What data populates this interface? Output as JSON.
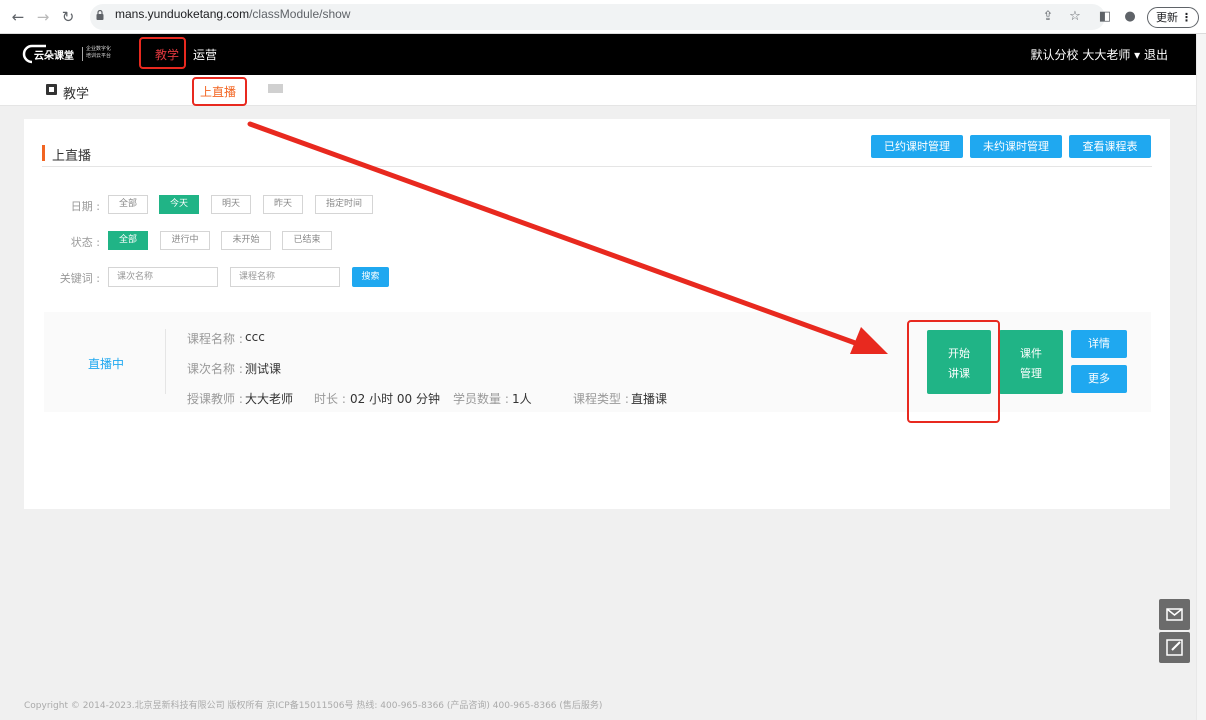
{
  "browser": {
    "url_domain": "mans.yunduoketang.com",
    "url_path": "/classModule/show",
    "update_label": "更新"
  },
  "topnav": {
    "logo_text": "云朵课堂",
    "logo_tagline": "企业数字化 培训云平台",
    "items": [
      {
        "label": "教学",
        "active": true
      },
      {
        "label": "运营",
        "active": false
      }
    ],
    "right_text": "默认分校 大大老师 ▾ 退出"
  },
  "subnav": {
    "title": "教学",
    "tab": "上直播"
  },
  "section": {
    "title": "上直播",
    "buttons": [
      "已约课时管理",
      "未约课时管理",
      "查看课程表"
    ]
  },
  "filters": {
    "date_label": "日期 :",
    "date_options": [
      {
        "label": "全部",
        "selected": false
      },
      {
        "label": "今天",
        "selected": true
      },
      {
        "label": "明天",
        "selected": false
      },
      {
        "label": "昨天",
        "selected": false
      },
      {
        "label": "指定时间",
        "selected": false
      }
    ],
    "status_label": "状态 :",
    "status_options": [
      {
        "label": "全部",
        "selected": true
      },
      {
        "label": "进行中",
        "selected": false
      },
      {
        "label": "未开始",
        "selected": false
      },
      {
        "label": "已结束",
        "selected": false
      }
    ],
    "keyword_label": "关键词 :",
    "keyword_placeholder_1": "课次名称",
    "keyword_placeholder_2": "课程名称",
    "search_label": "搜索"
  },
  "course": {
    "status": "直播中",
    "course_name_label": "课程名称 :",
    "course_name": "ccc",
    "lesson_name_label": "课次名称 :",
    "lesson_name": "测试课",
    "teacher_label": "授课教师 :",
    "teacher": "大大老师",
    "duration_label": "时长 :",
    "duration": "02 小时 00 分钟",
    "students_label": "学员数量 :",
    "students": "1人",
    "type_label": "课程类型 :",
    "type": "直播课",
    "actions": {
      "start_line1": "开始",
      "start_line2": "讲课",
      "courseware_line1": "课件",
      "courseware_line2": "管理",
      "detail": "详情",
      "more": "更多"
    }
  },
  "footer": {
    "text": "Copyright © 2014-2023.北京昱新科技有限公司 版权所有 京ICP备15011506号     热线: 400-965-8366 (产品咨询)  400-965-8366 (售后服务)"
  },
  "colors": {
    "primary_green": "#20b486",
    "primary_blue": "#1fa8f0",
    "accent_orange": "#f26522",
    "annotation_red": "#e8291f"
  }
}
